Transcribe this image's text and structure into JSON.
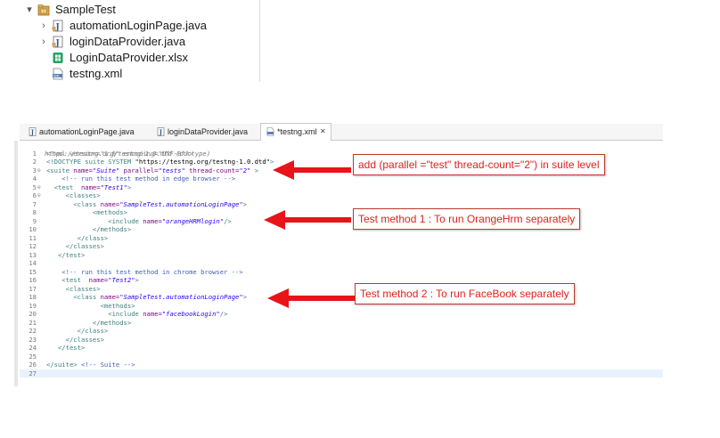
{
  "colors": {
    "annotation_border": "#c0392b",
    "annotation_text": "#e02020",
    "arrow": "#e8141a",
    "tag": "#3f7f7f",
    "attribute": "#7f007f",
    "value": "#2a00ff",
    "comment": "#3f5fbf"
  },
  "explorer": {
    "project": {
      "label": "SampleTest",
      "icon": "package-folder-icon",
      "expander": "▾"
    },
    "items": [
      {
        "label": "automationLoginPage.java",
        "icon": "java-file-icon",
        "expander": "›"
      },
      {
        "label": "loginDataProvider.java",
        "icon": "java-file-icon",
        "expander": "›"
      },
      {
        "label": "LoginDataProvider.xlsx",
        "icon": "excel-file-icon",
        "expander": ""
      },
      {
        "label": "testng.xml",
        "icon": "xml-file-icon",
        "expander": ""
      }
    ]
  },
  "editor": {
    "tabs": [
      {
        "label": "automationLoginPage.java",
        "icon": "java-file-icon"
      },
      {
        "label": "loginDataProvider.java",
        "icon": "java-file-icon"
      },
      {
        "label": "*testng.xml",
        "icon": "xml-file-icon",
        "active": true,
        "close": "✕"
      }
    ],
    "header_line": "https://testng.org/testng-1.0.dtd (doctype)",
    "lines": [
      {
        "n": "1",
        "fold": "",
        "segs": [
          [
            "pi",
            "<?xml version=\"1.0\" encoding=\"UTF-8\"?>"
          ]
        ]
      },
      {
        "n": "2",
        "fold": "",
        "segs": [
          [
            "tag",
            "<!DOCTYPE suite SYSTEM "
          ],
          [
            "txt",
            "\"https://testng.org/testng-1.0.dtd\""
          ],
          [
            "tag",
            ">"
          ]
        ]
      },
      {
        "n": "3",
        "fold": "⊖",
        "segs": [
          [
            "tag",
            "<suite "
          ],
          [
            "att",
            "name="
          ],
          [
            "val",
            "\"Suite\""
          ],
          [
            "att",
            " parallel="
          ],
          [
            "val",
            "\"tests\""
          ],
          [
            "att",
            " thread-count="
          ],
          [
            "val",
            "\"2\""
          ],
          [
            "tag",
            " >"
          ]
        ]
      },
      {
        "n": "4",
        "fold": "",
        "segs": [
          [
            "com",
            "    <!-- run this test method in edge browser -->"
          ]
        ]
      },
      {
        "n": "5",
        "fold": "⊖",
        "segs": [
          [
            "tag",
            "  <test "
          ],
          [
            "att",
            " name="
          ],
          [
            "val",
            "\"Test1\""
          ],
          [
            "tag",
            ">"
          ]
        ]
      },
      {
        "n": "6",
        "fold": "⊖",
        "segs": [
          [
            "tag",
            "     <classes>"
          ]
        ]
      },
      {
        "n": "7",
        "fold": "",
        "segs": [
          [
            "tag",
            "       <class "
          ],
          [
            "att",
            "name="
          ],
          [
            "val",
            "\"SampleTest.automationLoginPage\""
          ],
          [
            "tag",
            ">"
          ]
        ]
      },
      {
        "n": "8",
        "fold": "",
        "segs": [
          [
            "tag",
            "            <methods>"
          ]
        ]
      },
      {
        "n": "9",
        "fold": "",
        "segs": [
          [
            "tag",
            "                <include "
          ],
          [
            "att",
            "name="
          ],
          [
            "val",
            "\"orangeHRMlogin\""
          ],
          [
            "tag",
            "/>"
          ]
        ]
      },
      {
        "n": "10",
        "fold": "",
        "segs": [
          [
            "tag",
            "            </methods>"
          ]
        ]
      },
      {
        "n": "11",
        "fold": "",
        "segs": [
          [
            "tag",
            "        </class>"
          ]
        ]
      },
      {
        "n": "12",
        "fold": "",
        "segs": [
          [
            "tag",
            "     </classes>"
          ]
        ]
      },
      {
        "n": "13",
        "fold": "",
        "segs": [
          [
            "tag",
            "   </test>"
          ]
        ]
      },
      {
        "n": "14",
        "fold": "",
        "segs": []
      },
      {
        "n": "15",
        "fold": "",
        "segs": [
          [
            "com",
            "    <!-- run this test method in chrome browser -->"
          ]
        ]
      },
      {
        "n": "16",
        "fold": "",
        "segs": [
          [
            "tag",
            "    <test "
          ],
          [
            "att",
            " name="
          ],
          [
            "val",
            "\"Test2\""
          ],
          [
            "tag",
            ">"
          ]
        ]
      },
      {
        "n": "17",
        "fold": "",
        "segs": [
          [
            "tag",
            "     <classes>"
          ]
        ]
      },
      {
        "n": "18",
        "fold": "",
        "segs": [
          [
            "tag",
            "       <class "
          ],
          [
            "att",
            "name="
          ],
          [
            "val",
            "\"SampleTest.automationLoginPage\""
          ],
          [
            "tag",
            ">"
          ]
        ]
      },
      {
        "n": "19",
        "fold": "",
        "segs": [
          [
            "tag",
            "              <methods>"
          ]
        ]
      },
      {
        "n": "20",
        "fold": "",
        "segs": [
          [
            "tag",
            "                <include "
          ],
          [
            "att",
            "name="
          ],
          [
            "val",
            "\"facebookLogin\""
          ],
          [
            "tag",
            "/>"
          ]
        ]
      },
      {
        "n": "21",
        "fold": "",
        "segs": [
          [
            "tag",
            "            </methods>"
          ]
        ]
      },
      {
        "n": "22",
        "fold": "",
        "segs": [
          [
            "tag",
            "        </class>"
          ]
        ]
      },
      {
        "n": "23",
        "fold": "",
        "segs": [
          [
            "tag",
            "     </classes>"
          ]
        ]
      },
      {
        "n": "24",
        "fold": "",
        "segs": [
          [
            "tag",
            "   </test>"
          ]
        ]
      },
      {
        "n": "25",
        "fold": "",
        "segs": []
      },
      {
        "n": "26",
        "fold": "",
        "segs": [
          [
            "tag",
            "</suite>"
          ],
          [
            "com",
            " <!-- Suite -->"
          ]
        ]
      },
      {
        "n": "27",
        "fold": "",
        "segs": [],
        "highlight": true
      }
    ]
  },
  "annotations": [
    {
      "text": "add (parallel =\"test\" thread-count=\"2\") in suite level"
    },
    {
      "text": "Test method 1 : To run OrangeHrm separately"
    },
    {
      "text": "Test method 2 : To run FaceBook separately"
    }
  ]
}
